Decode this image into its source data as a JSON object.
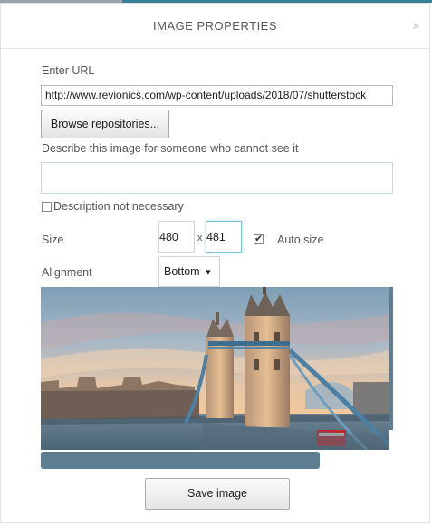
{
  "dialog": {
    "title": "IMAGE PROPERTIES",
    "close_glyph": "×"
  },
  "url": {
    "label": "Enter URL",
    "value": "http://www.revionics.com/wp-content/uploads/2018/07/shutterstock"
  },
  "browse_label": "Browse repositories...",
  "description": {
    "label": "Describe this image for someone who cannot see it",
    "value": "",
    "not_necessary_label": "Description not necessary",
    "not_necessary_checked": false
  },
  "size": {
    "label": "Size",
    "width": "480",
    "height": "481",
    "separator": "x",
    "auto_size_label": "Auto size",
    "auto_size_checked": true
  },
  "alignment": {
    "label": "Alignment",
    "selected": "Bottom",
    "arrow": "▾"
  },
  "save_label": "Save image",
  "colors": {
    "accent": "#3b7f99",
    "scrollbar": "#5d7d90"
  }
}
